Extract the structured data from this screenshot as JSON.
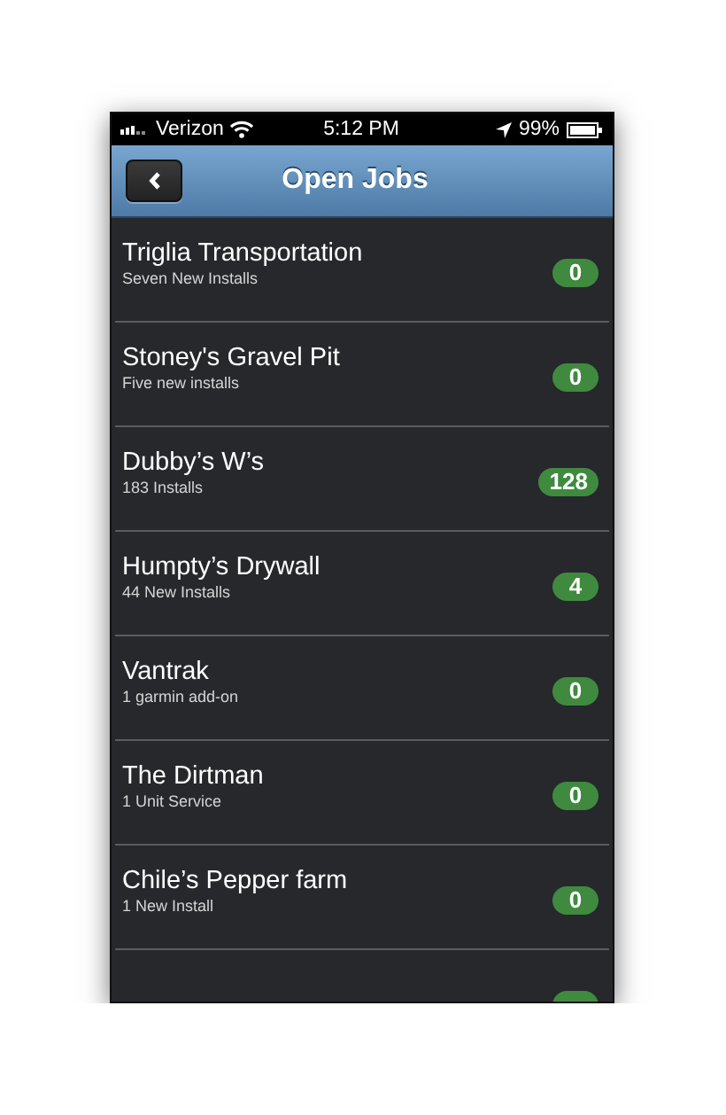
{
  "status_bar": {
    "carrier": "Verizon",
    "time": "5:12 PM",
    "battery": "99%"
  },
  "header": {
    "title": "Open Jobs"
  },
  "jobs": [
    {
      "kind": "job",
      "title": "Triglia Transportation",
      "subtitle": "Seven New Installs",
      "count": "0"
    },
    {
      "kind": "job",
      "title": "Stoney's Gravel Pit",
      "subtitle": "Five new installs",
      "count": "0"
    },
    {
      "kind": "job",
      "title": "Dubby’s W’s",
      "subtitle": "183 Installs",
      "count": "128"
    },
    {
      "kind": "job",
      "title": "Humpty’s Drywall",
      "subtitle": "44 New Installs",
      "count": "4"
    },
    {
      "kind": "job",
      "title": "Vantrak",
      "subtitle": "1 garmin add-on",
      "count": "0"
    },
    {
      "kind": "job",
      "title": "The Dirtman",
      "subtitle": "1 Unit Service",
      "count": "0"
    },
    {
      "kind": "job",
      "title": "Chile’s Pepper farm",
      "subtitle": "1 New Install",
      "count": "0"
    },
    {
      "kind": "partial"
    }
  ]
}
